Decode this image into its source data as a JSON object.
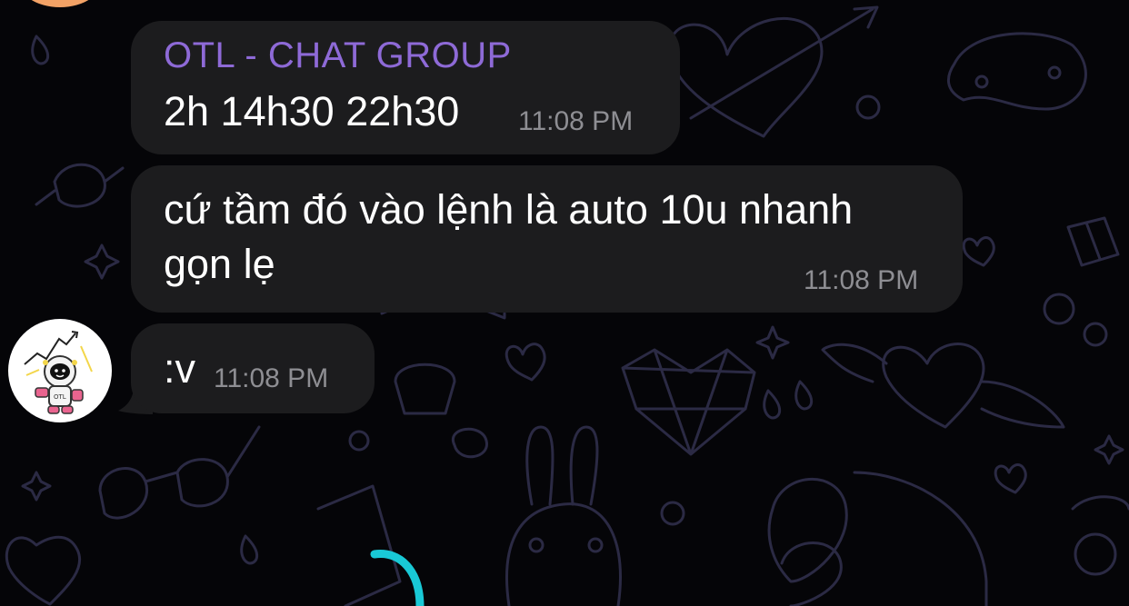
{
  "chat": {
    "messages": [
      {
        "sender": "OTL - CHAT GROUP",
        "text_lines": [
          "2h 14h30 22h30"
        ],
        "time": "11:08 PM"
      },
      {
        "text_lines": [
          "cứ tầm đó vào lệnh là auto 10u nhanh",
          "gọn lẹ"
        ],
        "time": "11:08 PM"
      },
      {
        "text_lines": [
          ":v"
        ],
        "time": "11:08 PM"
      }
    ]
  },
  "colors": {
    "background": "#050508",
    "bubble": "#1c1c1e",
    "sender_name": "#8e6ad7",
    "timestamp": "#8e8e93",
    "doodle": "#2b2a44",
    "loading_indicator": "#19c9d6"
  },
  "icons": {
    "loading": "loading-spinner-icon",
    "avatar": "astronaut-avatar"
  }
}
